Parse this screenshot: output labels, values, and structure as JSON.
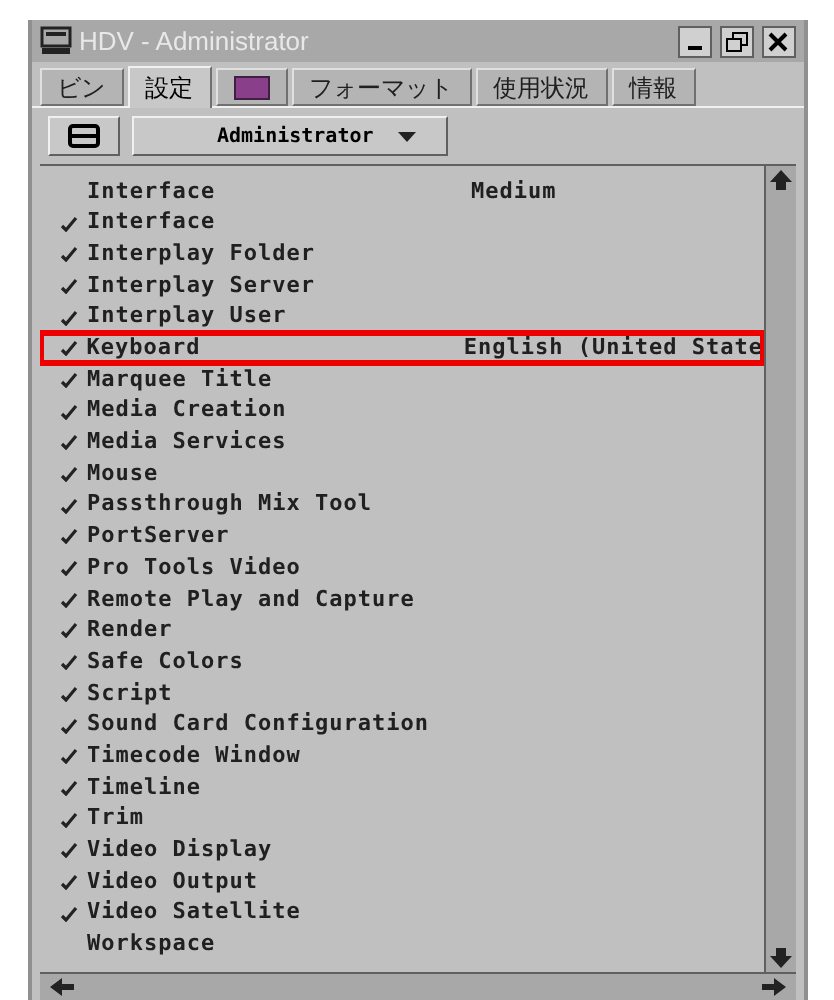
{
  "window": {
    "title": "HDV - Administrator"
  },
  "tabs": [
    {
      "kind": "text",
      "label": "ビン",
      "selected": false
    },
    {
      "kind": "text",
      "label": "設定",
      "selected": true
    },
    {
      "kind": "icon",
      "selected": false
    },
    {
      "kind": "text",
      "label": "フォーマット",
      "selected": false
    },
    {
      "kind": "text",
      "label": "使用状況",
      "selected": false
    },
    {
      "kind": "text",
      "label": "情報",
      "selected": false
    }
  ],
  "toolbar": {
    "user_menu": "Administrator"
  },
  "settings": [
    {
      "name": "Interface",
      "value": "Medium",
      "checked": false,
      "highlighted": false
    },
    {
      "name": "Interface",
      "checked": true,
      "highlighted": false
    },
    {
      "name": "Interplay Folder",
      "checked": true,
      "highlighted": false
    },
    {
      "name": "Interplay Server",
      "checked": true,
      "highlighted": false
    },
    {
      "name": "Interplay User",
      "checked": true,
      "highlighted": false
    },
    {
      "name": "Keyboard",
      "value": "English (United State",
      "checked": true,
      "highlighted": true
    },
    {
      "name": "Marquee Title",
      "checked": true,
      "highlighted": false
    },
    {
      "name": "Media Creation",
      "checked": true,
      "highlighted": false
    },
    {
      "name": "Media Services",
      "checked": true,
      "highlighted": false
    },
    {
      "name": "Mouse",
      "checked": true,
      "highlighted": false
    },
    {
      "name": "Passthrough Mix Tool",
      "checked": true,
      "highlighted": false
    },
    {
      "name": "PortServer",
      "checked": true,
      "highlighted": false
    },
    {
      "name": "Pro Tools Video",
      "checked": true,
      "highlighted": false
    },
    {
      "name": "Remote Play and Capture",
      "checked": true,
      "highlighted": false
    },
    {
      "name": "Render",
      "checked": true,
      "highlighted": false
    },
    {
      "name": "Safe Colors",
      "checked": true,
      "highlighted": false
    },
    {
      "name": "Script",
      "checked": true,
      "highlighted": false
    },
    {
      "name": "Sound Card Configuration",
      "checked": true,
      "highlighted": false
    },
    {
      "name": "Timecode Window",
      "checked": true,
      "highlighted": false
    },
    {
      "name": "Timeline",
      "checked": true,
      "highlighted": false
    },
    {
      "name": "Trim",
      "checked": true,
      "highlighted": false
    },
    {
      "name": "Video Display",
      "checked": true,
      "highlighted": false
    },
    {
      "name": "Video Output",
      "checked": true,
      "highlighted": false
    },
    {
      "name": "Video Satellite",
      "checked": true,
      "highlighted": false
    },
    {
      "name": "Workspace",
      "checked": false,
      "highlighted": false
    }
  ]
}
